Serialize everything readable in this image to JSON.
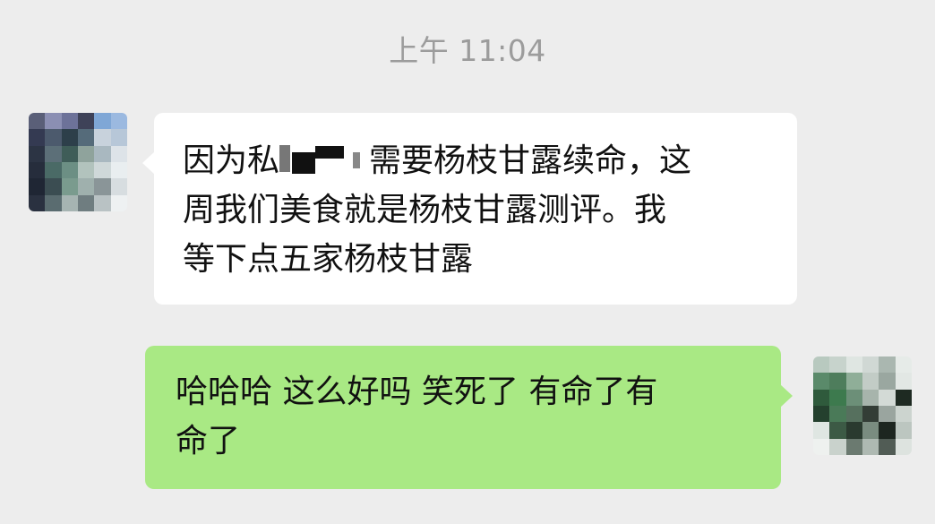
{
  "chat": {
    "timestamp": "上午 11:04",
    "incoming": {
      "line1_before": "因为私",
      "line1_after": "需要杨枝甘露续命，这",
      "line2": "周我们美食就是杨枝甘露测评。我",
      "line3": "等下点五家杨枝甘露"
    },
    "outgoing": {
      "line1": "哈哈哈 这么好吗 笑死了 有命了有",
      "line2": "命了"
    }
  },
  "colors": {
    "background": "#ededed",
    "incoming_bubble": "#ffffff",
    "outgoing_bubble": "#a9e984",
    "timestamp_text": "#9c9c9c"
  }
}
